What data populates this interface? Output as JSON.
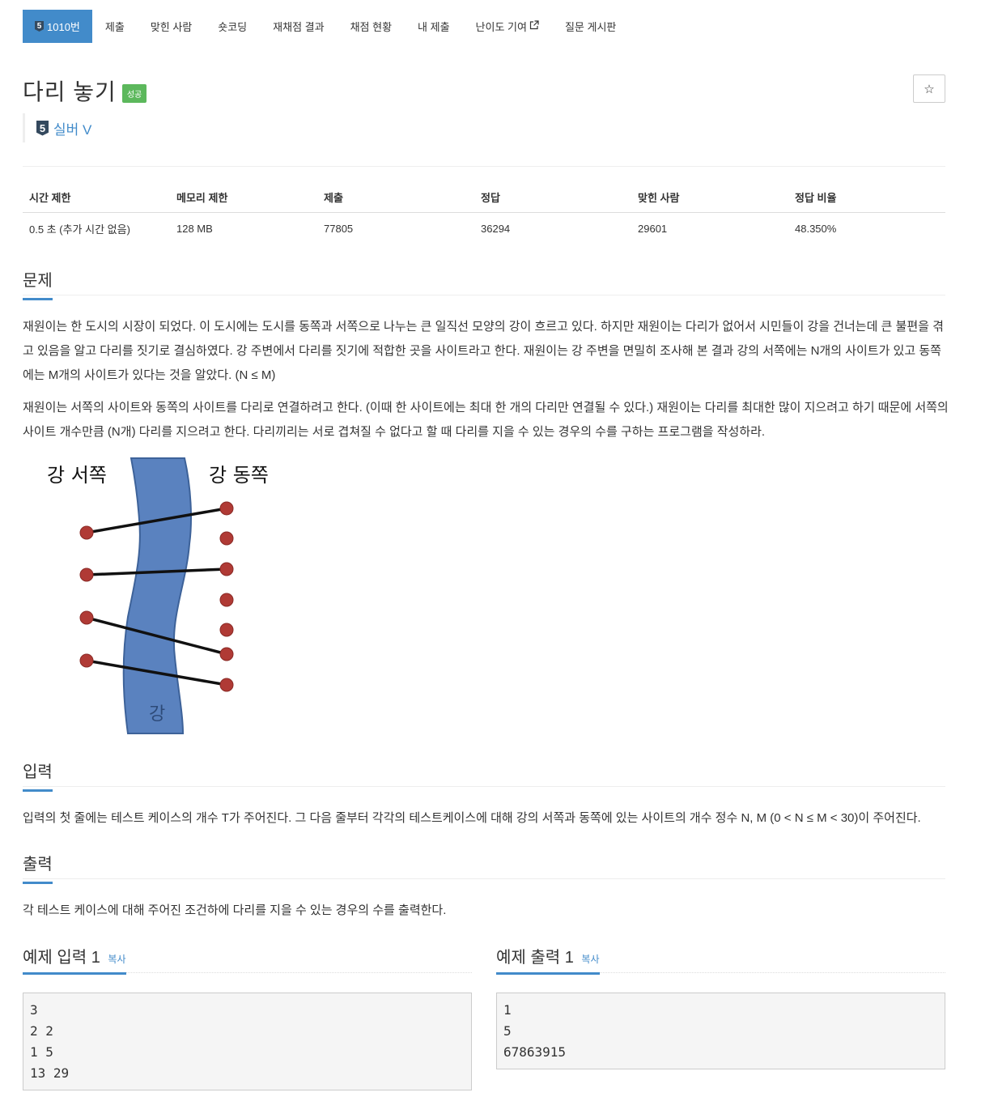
{
  "nav": {
    "problem_tier": "5",
    "tabs": [
      {
        "label": "1010번",
        "active": true
      },
      {
        "label": "제출"
      },
      {
        "label": "맞힌 사람"
      },
      {
        "label": "숏코딩"
      },
      {
        "label": "재채점 결과"
      },
      {
        "label": "채점 현황"
      },
      {
        "label": "내 제출"
      },
      {
        "label": "난이도 기여",
        "icon": "external-link-icon"
      },
      {
        "label": "질문 게시판"
      }
    ]
  },
  "problem": {
    "title": "다리 놓기",
    "status_label": "성공",
    "star_icon": "☆",
    "tier_number": "5",
    "tier_text": "실버 V"
  },
  "stats": {
    "headers": [
      "시간 제한",
      "메모리 제한",
      "제출",
      "정답",
      "맞힌 사람",
      "정답 비율"
    ],
    "values": [
      "0.5 초 (추가 시간 없음)",
      "128 MB",
      "77805",
      "36294",
      "29601",
      "48.350%"
    ]
  },
  "sections": {
    "problem_heading": "문제",
    "problem_p1": "재원이는 한 도시의 시장이 되었다. 이 도시에는 도시를 동쪽과 서쪽으로 나누는 큰 일직선 모양의 강이 흐르고 있다. 하지만 재원이는 다리가 없어서 시민들이 강을 건너는데 큰 불편을 겪고 있음을 알고 다리를 짓기로 결심하였다. 강 주변에서 다리를 짓기에 적합한 곳을 사이트라고 한다. 재원이는 강 주변을 면밀히 조사해 본 결과 강의 서쪽에는 N개의 사이트가 있고 동쪽에는 M개의 사이트가 있다는 것을 알았다. (N ≤ M)",
    "problem_p2": "재원이는 서쪽의 사이트와 동쪽의 사이트를 다리로 연결하려고 한다. (이때 한 사이트에는 최대 한 개의 다리만 연결될 수 있다.) 재원이는 다리를 최대한 많이 지으려고 하기 때문에 서쪽의 사이트 개수만큼 (N개) 다리를 지으려고 한다. 다리끼리는 서로 겹쳐질 수 없다고 할 때 다리를 지을 수 있는 경우의 수를 구하는 프로그램을 작성하라.",
    "input_heading": "입력",
    "input_text": "입력의 첫 줄에는 테스트 케이스의 개수 T가 주어진다. 그 다음 줄부터 각각의 테스트케이스에 대해 강의 서쪽과 동쪽에 있는 사이트의 개수 정수 N, M (0 < N ≤ M < 30)이 주어진다.",
    "output_heading": "출력",
    "output_text": "각 테스트 케이스에 대해 주어진 조건하에 다리를 지을 수 있는 경우의 수를 출력한다."
  },
  "figure": {
    "west_label": "강 서쪽",
    "east_label": "강 동쪽",
    "river_label": "강",
    "river_color": "#5a82bf",
    "dot_color": "#b03a35"
  },
  "samples": {
    "input_title": "예제 입력 1",
    "output_title": "예제 출력 1",
    "copy_label": "복사",
    "input_text": "3\n2 2\n1 5\n13 29",
    "output_text": "1\n5\n67863915"
  }
}
